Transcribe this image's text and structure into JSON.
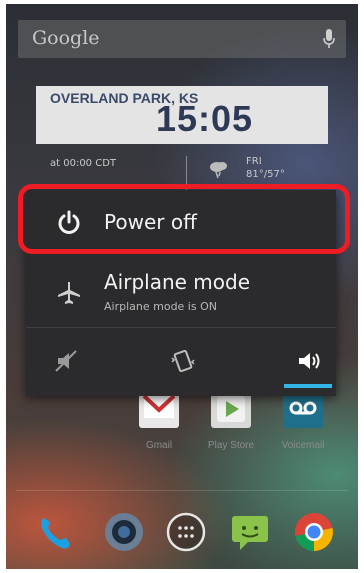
{
  "search": {
    "label": "Google",
    "mic_icon": "microphone-icon"
  },
  "clock_widget": {
    "city": "OVERLAND PARK, KS",
    "time": "15:05"
  },
  "weather_widget": {
    "updated": "at 00:00 CDT",
    "day": "FRI",
    "high_low": "81°/57°",
    "icon": "cloud-rain-icon"
  },
  "power_menu": {
    "power_off": {
      "label": "Power off",
      "icon": "power-icon"
    },
    "airplane": {
      "label": "Airplane mode",
      "status": "Airplane mode is ON",
      "icon": "airplane-icon"
    },
    "ringer_modes": [
      {
        "name": "silent",
        "icon": "mute-icon"
      },
      {
        "name": "vibrate",
        "icon": "vibrate-icon"
      },
      {
        "name": "sound",
        "icon": "volume-icon",
        "selected": true
      }
    ],
    "accent_color": "#33b5e5",
    "highlight_color": "#ee1c24"
  },
  "home_apps": [
    {
      "label": "Gmail",
      "icon": "gmail-icon"
    },
    {
      "label": "Play Store",
      "icon": "play-store-icon"
    },
    {
      "label": "Voicemail",
      "icon": "voicemail-icon"
    }
  ],
  "dock": [
    "phone-icon",
    "camera-icon",
    "app-drawer-icon",
    "messaging-icon",
    "chrome-icon"
  ]
}
